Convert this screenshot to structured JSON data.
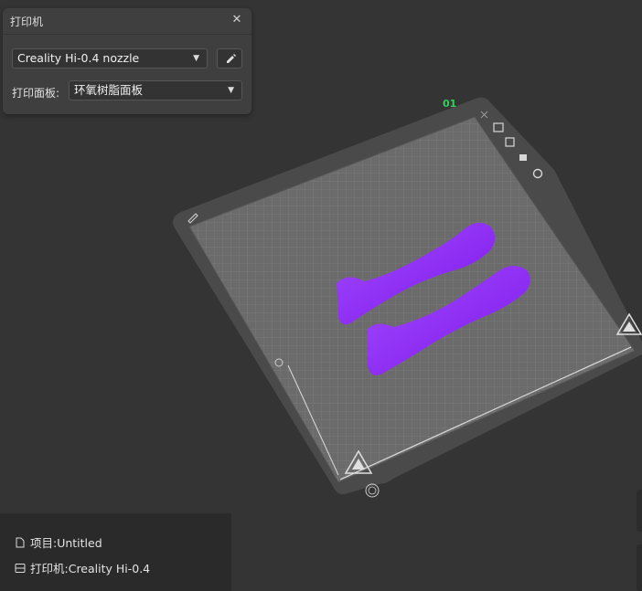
{
  "printer_panel": {
    "title": "打印机",
    "printer_select": "Creality Hi-0.4 nozzle",
    "plate_label": "打印面板:",
    "plate_select": "环氧树脂面板"
  },
  "viewport": {
    "plate_number": "01",
    "colors": {
      "background": "#343434",
      "bed_surface": "#6b6b6b",
      "model": "#8c2bf2",
      "plate_number": "#2fd15a"
    }
  },
  "info_panel": {
    "project": "项目:Untitled",
    "printer": "打印机:Creality Hi-0.4"
  }
}
